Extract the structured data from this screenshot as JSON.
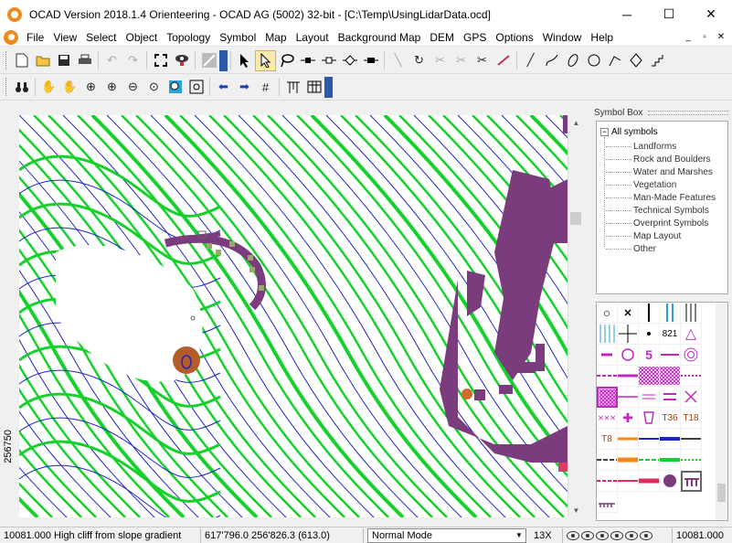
{
  "window": {
    "title": "OCAD Version 2018.1.4  Orienteering - OCAD AG (5002) 32-bit - [C:\\Temp\\UsingLidarData.ocd]",
    "minimize": "─",
    "maximize": "☐",
    "close": "✕"
  },
  "menu": {
    "items": [
      "File",
      "View",
      "Select",
      "Object",
      "Topology",
      "Symbol",
      "Map",
      "Layout",
      "Background Map",
      "DEM",
      "GPS",
      "Options",
      "Window",
      "Help"
    ],
    "mdi_min": "_",
    "mdi_restore": "▫",
    "mdi_close": "✕"
  },
  "toolbar1": {
    "icons": [
      "new-file-icon",
      "open-folder-icon",
      "save-icon",
      "print-icon",
      "undo-icon",
      "redo-icon",
      "fullscreen-icon",
      "preview-icon",
      "fill-icon",
      "select-object-icon",
      "edit-point-icon",
      "lasso-icon",
      "move-point-icon",
      "add-point-icon",
      "delete-point-icon",
      "corner-point-icon",
      "cut-line-icon",
      "rotate-icon",
      "scissors-alt-icon",
      "scissors-icon",
      "cut-icon",
      "measure-icon",
      "straight-line-icon",
      "curve-icon",
      "ellipse-icon",
      "circle-icon",
      "freehand-icon",
      "rectangle-icon",
      "stairs-icon"
    ]
  },
  "toolbar2": {
    "icons": [
      "binoculars-icon",
      "pan-hand-icon",
      "pan-hand-alt-icon",
      "zoom-in-icon",
      "zoom-in-alt-icon",
      "zoom-out-icon",
      "zoom-window-icon",
      "zoom-selection-icon",
      "zoom-fit-icon",
      "back-icon",
      "forward-icon",
      "grid-icon",
      "columns-icon",
      "table-icon"
    ]
  },
  "ruler": {
    "label": "256750"
  },
  "symbol_box": {
    "header": "Symbol Box",
    "root": "All symbols",
    "root_toggle": "−",
    "categories": [
      "Landforms",
      "Rock and Boulders",
      "Water and Marshes",
      "Vegetation",
      "Man-Made Features",
      "Technical Symbols",
      "Overprint Symbols",
      "Map Layout",
      "Other"
    ],
    "symbol_labels": {
      "dot_circle": "○",
      "cross": "✕",
      "number": "821",
      "triangle": "△",
      "five": "5",
      "t36": "T36",
      "t18": "T18",
      "t8": "T8",
      "plus": "✚",
      "xs": "✕✕✕"
    }
  },
  "status": {
    "selected_symbol": "10081.000 High cliff from slope gradient",
    "coordinates": "617'796.0  256'826.3  (613.0)",
    "mode": "Normal Mode",
    "zoom": "13X",
    "current_symbol": "10081.000"
  },
  "colors": {
    "contour_green": "#16d12b",
    "contour_blue": "#1e24c8",
    "cliff_purple": "#7a3c7c",
    "accent_orange": "#f08a1c",
    "toolbar_active": "#fce9b0"
  }
}
